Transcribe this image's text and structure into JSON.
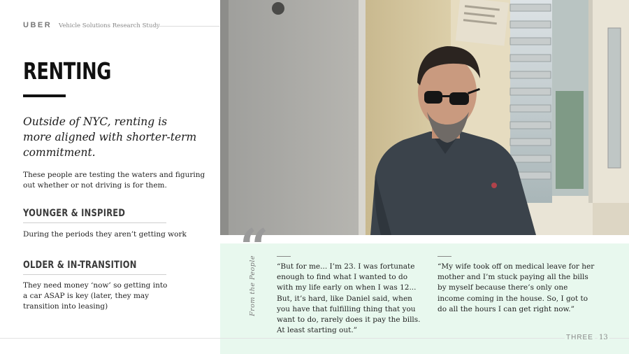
{
  "header": {
    "brand": "UBER",
    "study_title": "Vehicle Solutions Research Study"
  },
  "main": {
    "title": "RENTING",
    "lead": "Outside of NYC, renting is more aligned with shorter-term commitment.",
    "body": "These people are testing the waters and figuring out whether or not driving is for them.",
    "segments": [
      {
        "heading": "YOUNGER & INSPIRED",
        "text": "During the periods they aren’t getting work"
      },
      {
        "heading": "OLDER & IN-TRANSITION",
        "text": "They need money ‘now’ so getting into a car ASAP is key (later, they may transition into leasing)"
      }
    ]
  },
  "quotes": {
    "quote_mark": "“",
    "label": "From the People",
    "items": [
      "“But for me... I’m 23. I was fortunate enough to find what I wanted to do with my life early on when I was 12... But, it’s hard, like Daniel said, when you have that fulfilling thing that you want to do, rarely does it pay the bills. At least starting out.”",
      "“My wife took off on medical leave for her mother and I’m stuck paying all the bills by myself because there’s only one income coming in the house. So, I got to do all the hours I can get right now.”"
    ]
  },
  "footer": {
    "logo": "THREE",
    "page_number": "13"
  },
  "colors": {
    "quote_panel_bg": "#e8f8ee",
    "title_rule": "#111111"
  }
}
